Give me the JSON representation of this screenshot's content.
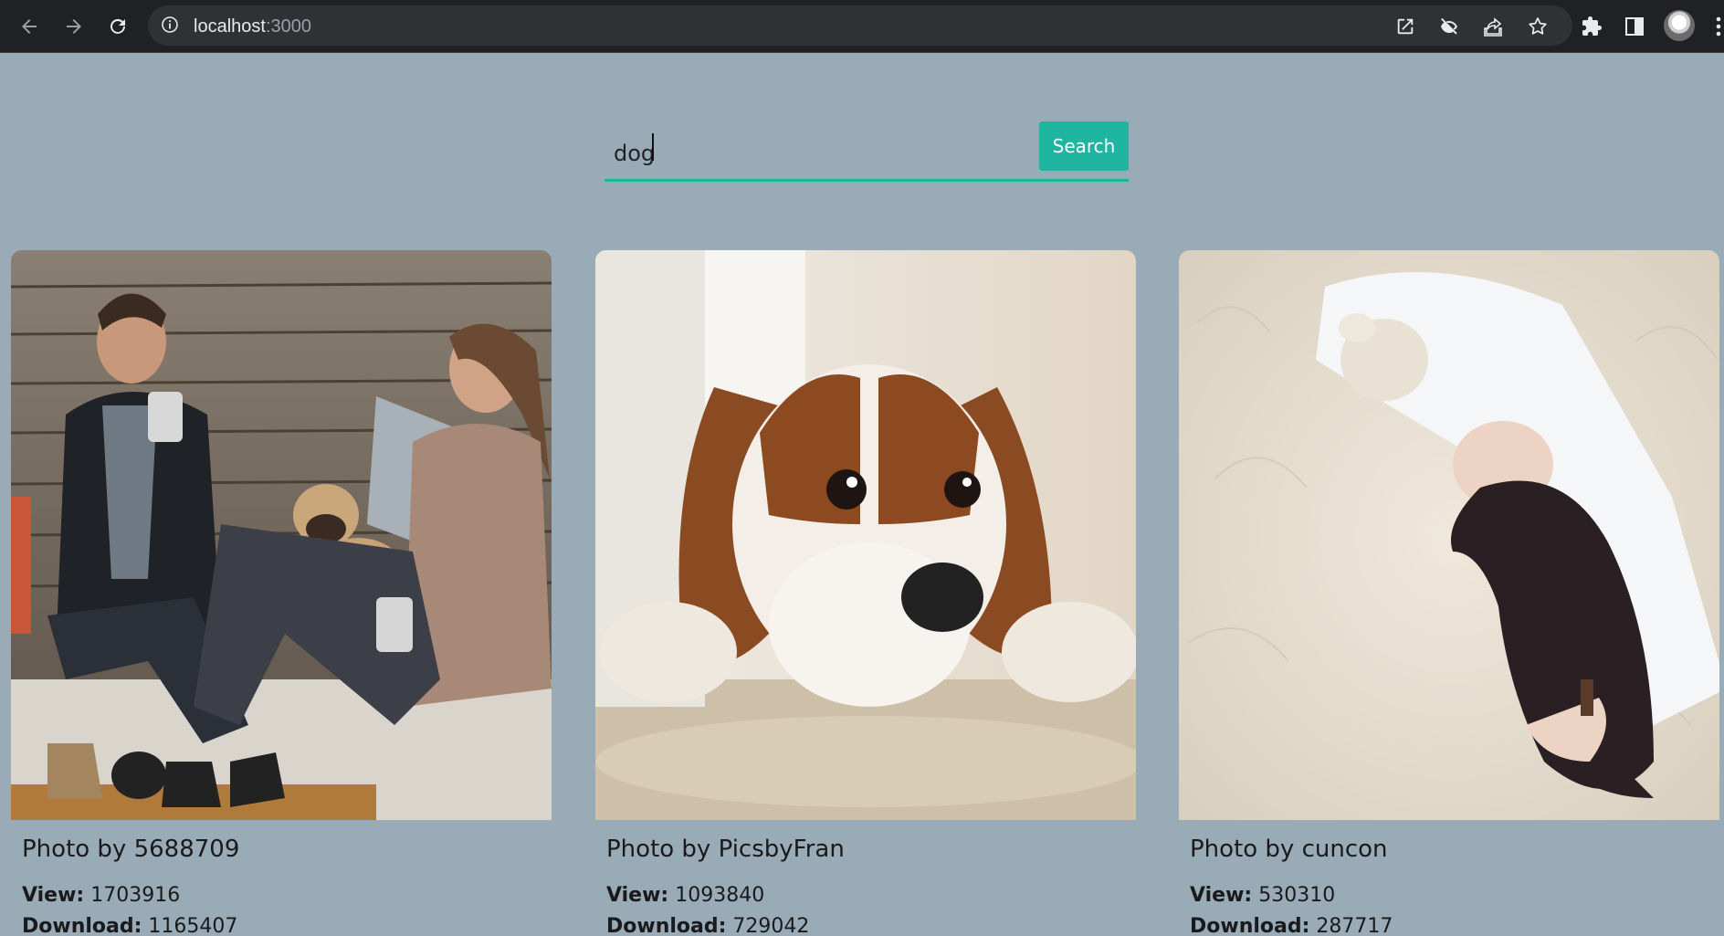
{
  "browser": {
    "url_host": "localhost",
    "url_port": ":3000",
    "icons": [
      "back-arrow-icon",
      "forward-arrow-icon",
      "reload-icon",
      "info-icon",
      "open-external-icon",
      "eye-off-icon",
      "share-icon",
      "star-icon",
      "extensions-puzzle-icon",
      "side-panel-icon",
      "profile-avatar",
      "more-vert-icon"
    ]
  },
  "search": {
    "value": "dog",
    "button_label": "Search"
  },
  "colors": {
    "page_background": "#9aabb8",
    "accent": "#1fb5a1"
  },
  "photos": [
    {
      "title": "Photo by 5688709",
      "view_label": "View:",
      "views": "1703916",
      "download_label": "Download:",
      "downloads": "1165407"
    },
    {
      "title": "Photo by PicsbyFran",
      "view_label": "View:",
      "views": "1093840",
      "download_label": "Download:",
      "downloads": "729042"
    },
    {
      "title": "Photo by cuncon",
      "view_label": "View:",
      "views": "530310",
      "download_label": "Download:",
      "downloads": "287717"
    }
  ]
}
